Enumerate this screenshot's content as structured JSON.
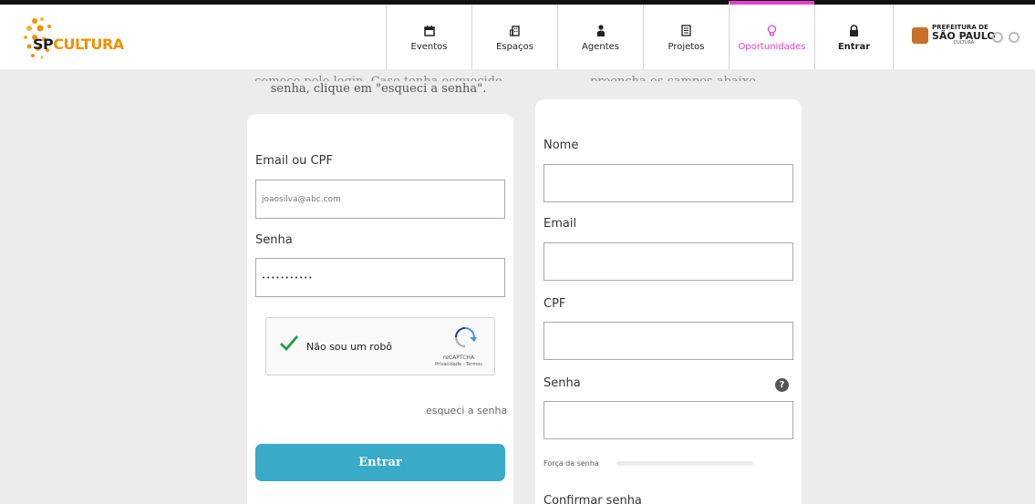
{
  "header": {
    "logo": {
      "sp": "SP",
      "cultura": "CULTURA"
    },
    "nav": [
      {
        "label": "Eventos",
        "icon": "calendar-icon"
      },
      {
        "label": "Espaços",
        "icon": "building-icon"
      },
      {
        "label": "Agentes",
        "icon": "person-icon"
      },
      {
        "label": "Projetos",
        "icon": "document-icon"
      },
      {
        "label": "Oportunidades",
        "icon": "lightbulb-icon",
        "active": true
      }
    ],
    "login_label": "Entrar",
    "prefeitura": {
      "line1": "PREFEITURA DE",
      "line2": "SÃO PAULO",
      "line3": "CULTURA"
    }
  },
  "intro": {
    "left_cut": "comece pelo login. Caso tenha esquecido sua",
    "left_line": "senha, clique em \"esqueci a senha\".",
    "right_cut": "preencha os campos abaixo."
  },
  "login": {
    "email_label": "Email ou CPF",
    "email_placeholder": "joaosilva@abc.com",
    "password_label": "Senha",
    "password_value": "•••••••••••",
    "captcha": {
      "text": "Não sou um robô",
      "brand": "reCAPTCHA",
      "links": "Privacidade - Termos"
    },
    "forgot": "esqueci a senha",
    "submit": "Entrar"
  },
  "signup": {
    "name_label": "Nome",
    "email_label": "Email",
    "cpf_label": "CPF",
    "password_label": "Senha",
    "help_icon": "?",
    "strength_label": "Força da senha",
    "confirm_label": "Confirmar senha"
  },
  "colors": {
    "accent": "#39aac8",
    "active_tab": "#e43fd0",
    "brand_orange": "#f29100"
  }
}
